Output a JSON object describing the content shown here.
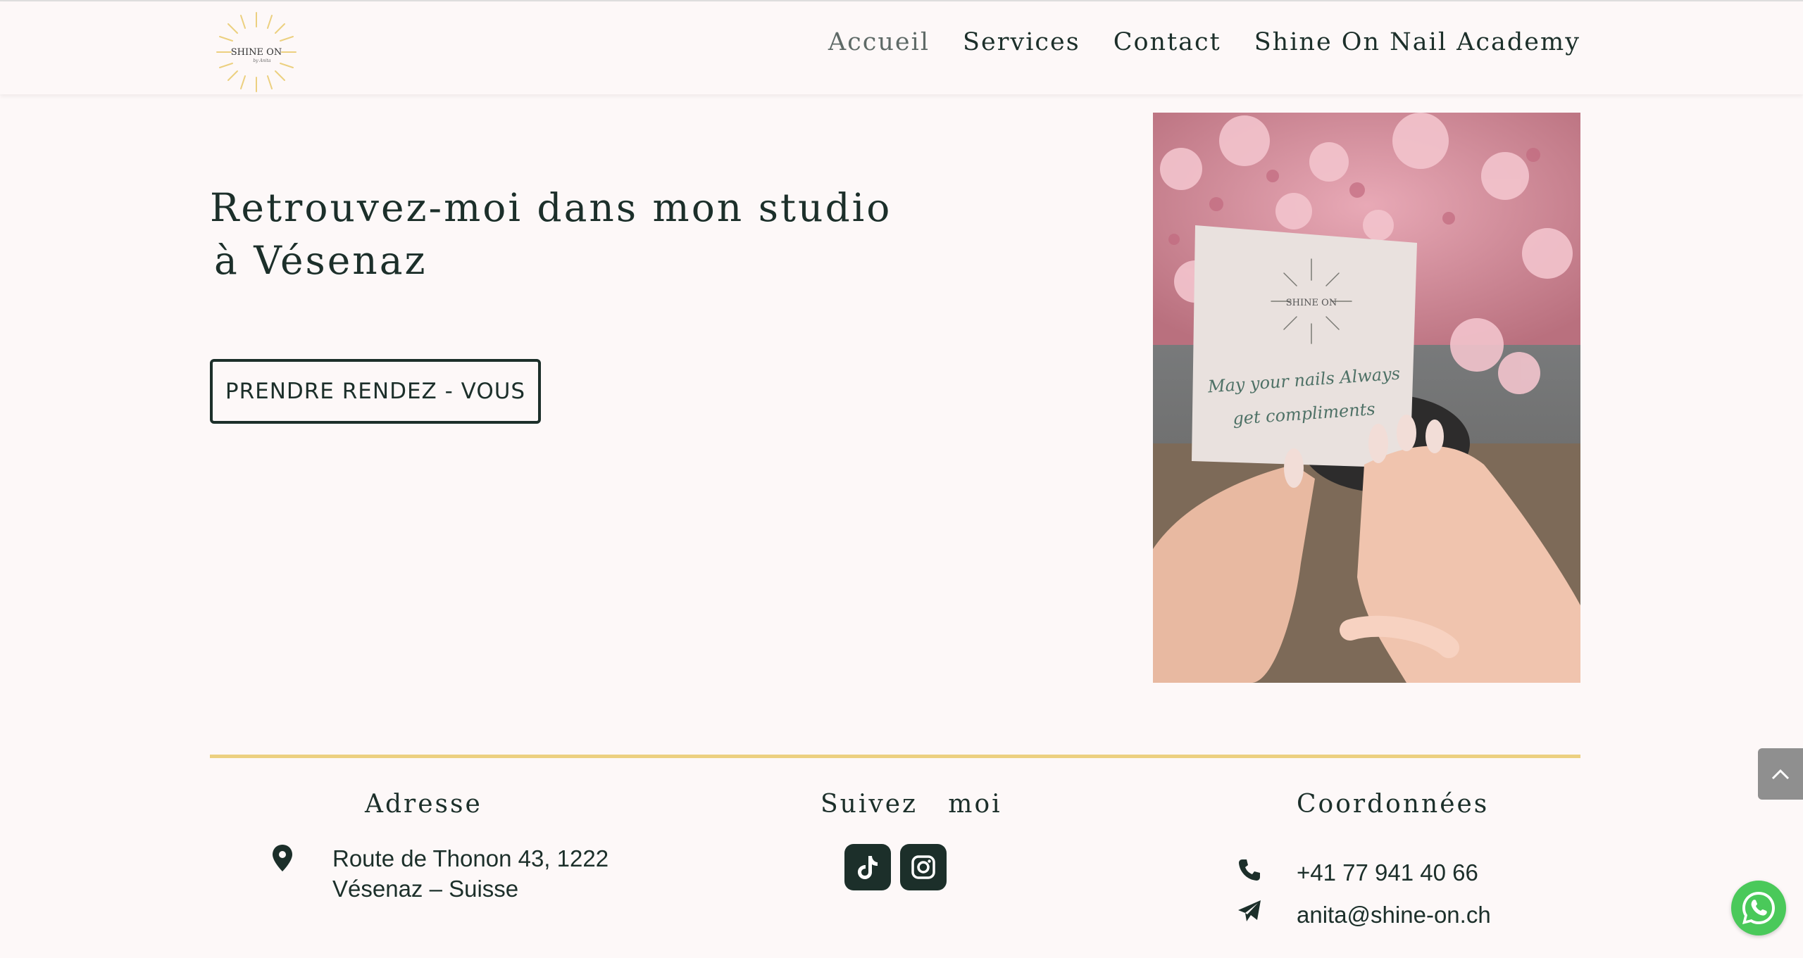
{
  "brand": {
    "logo_text": "SHINE ON",
    "logo_script": "by Anita",
    "gold": "#ecd080",
    "dark": "#1c2f2a"
  },
  "nav": {
    "items": [
      {
        "label": "Accueil",
        "active": true
      },
      {
        "label": "Services"
      },
      {
        "label": "Contact"
      },
      {
        "label": "Shine On Nail Academy"
      }
    ]
  },
  "hero": {
    "title_line1": "Retrouvez-moi dans mon studio",
    "title_line2": "à Vésenaz",
    "cta_label": "PRENDRE RENDEZ - VOUS",
    "photo": {
      "card_logo": "SHINE ON",
      "card_line1": "May your nails Always",
      "card_line2": "get compliments"
    }
  },
  "footer": {
    "address": {
      "heading": "Adresse",
      "line1": "Route de Thonon 43, 1222",
      "line2": "Vésenaz – Suisse",
      "icon": "map-pin-icon"
    },
    "social": {
      "heading": "Suivez   moi",
      "items": [
        {
          "icon": "tiktok-icon"
        },
        {
          "icon": "instagram-icon"
        }
      ]
    },
    "contact": {
      "heading": "Coordonnées",
      "phone": "+41 77 941 40 66",
      "email": "anita@shine-on.ch",
      "phone_icon": "phone-icon",
      "email_icon": "paper-plane-icon"
    }
  },
  "widgets": {
    "scroll_top_icon": "chevron-up-icon",
    "whatsapp_icon": "whatsapp-icon",
    "whatsapp_color": "#4ac95a"
  }
}
